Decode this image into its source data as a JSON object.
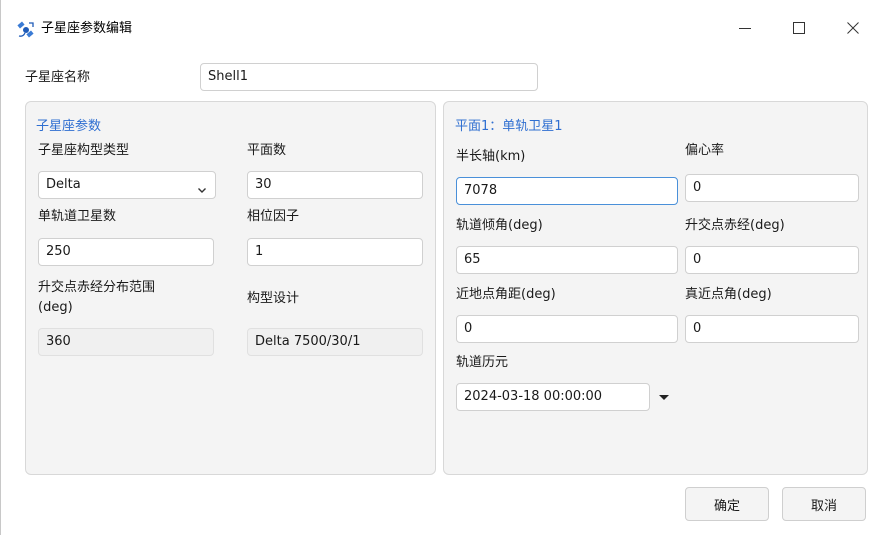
{
  "window": {
    "title": "子星座参数编辑"
  },
  "header": {
    "name_label": "子星座名称",
    "name_value": "Shell1"
  },
  "left_panel": {
    "title": "子星座参数",
    "config_type_label": "子星座构型类型",
    "config_type_value": "Delta",
    "planes_label": "平面数",
    "planes_value": "30",
    "sats_per_orbit_label": "单轨道卫星数",
    "sats_per_orbit_value": "250",
    "phase_factor_label": "相位因子",
    "phase_factor_value": "1",
    "raan_range_label_line1": "升交点赤经分布范围",
    "raan_range_label_line2": "(deg)",
    "raan_range_value": "360",
    "design_label": "构型设计",
    "design_value": "Delta 7500/30/1"
  },
  "right_panel": {
    "title": "平面1：单轨卫星1",
    "semi_major_axis_label": "半长轴(km)",
    "semi_major_axis_value": "7078",
    "eccentricity_label": "偏心率",
    "eccentricity_value": "0",
    "inclination_label": "轨道倾角(deg)",
    "inclination_value": "65",
    "raan_label": "升交点赤经(deg)",
    "raan_value": "0",
    "arg_perigee_label": "近地点角距(deg)",
    "arg_perigee_value": "0",
    "true_anomaly_label": "真近点角(deg)",
    "true_anomaly_value": "0",
    "epoch_label": "轨道历元",
    "epoch_value": "2024-03-18 00:00:00"
  },
  "footer": {
    "ok_label": "确定",
    "cancel_label": "取消"
  },
  "icons": {
    "app": "satellite-app-icon",
    "minimize": "minimize-icon",
    "maximize": "maximize-icon",
    "close": "close-icon",
    "chevron": "chevron-down-icon",
    "dropdown": "dropdown-arrow-icon"
  },
  "colors": {
    "accent": "#2f6fd1",
    "focus_border": "#4a90d9",
    "panel_bg": "#f4f4f4",
    "readonly_bg": "#f0f0f0"
  }
}
